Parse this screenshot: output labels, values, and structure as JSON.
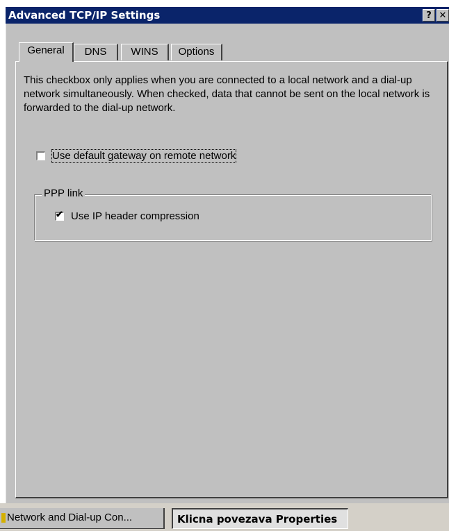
{
  "window": {
    "title": "Advanced TCP/IP Settings",
    "help_label": "?",
    "close_label": "✕"
  },
  "tabs": [
    {
      "label": "General",
      "active": true
    },
    {
      "label": "DNS",
      "active": false
    },
    {
      "label": "WINS",
      "active": false
    },
    {
      "label": "Options",
      "active": false
    }
  ],
  "general": {
    "description": "This checkbox only applies when you are connected to a local network and a dial-up network simultaneously.  When checked, data that cannot be sent on the local network is forwarded to the dial-up network.",
    "default_gateway": {
      "label": "Use default gateway on remote network",
      "checked": false
    },
    "ppp_group": {
      "legend": "PPP link",
      "ip_header_compression": {
        "label": "Use IP header compression",
        "checked": true
      }
    }
  },
  "taskbar": {
    "items": [
      {
        "label": "Network and Dial-up Con..."
      },
      {
        "label": "Klicna povezava Properties"
      }
    ]
  },
  "colors": {
    "titlebar": "#0a246a",
    "face": "#c0c0c0",
    "shadow": "#404040",
    "highlight": "#ffffff"
  }
}
